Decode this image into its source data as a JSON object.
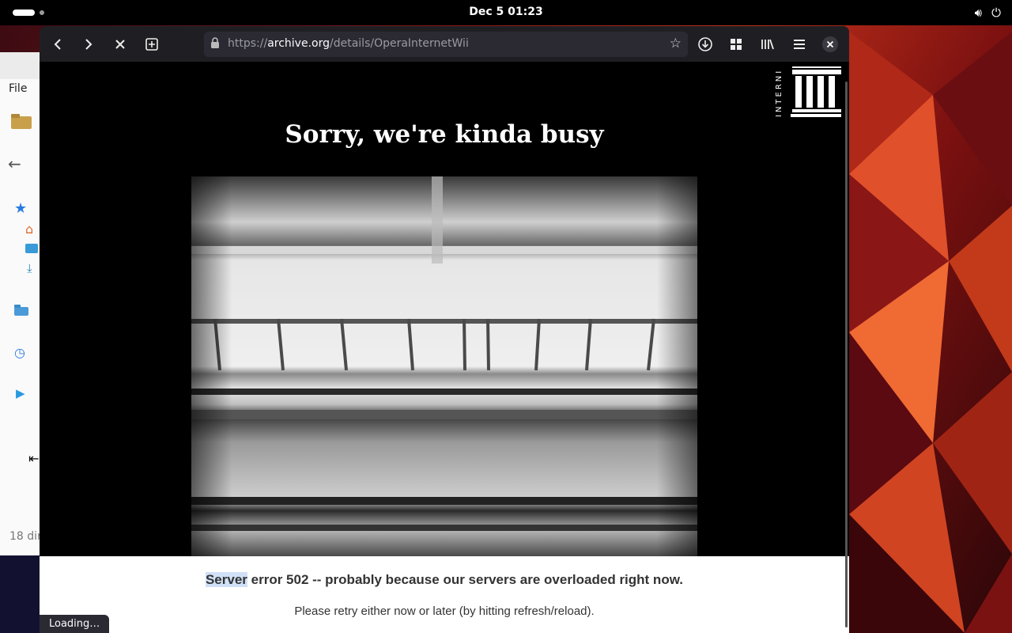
{
  "topbar": {
    "clock": "Dec 5  01:23",
    "volume_icon": "volume-icon",
    "power_icon": "power-icon"
  },
  "file_manager": {
    "menu_file": "File",
    "footer": "18 dir"
  },
  "browser": {
    "url_scheme": "https://",
    "url_host": "archive.org",
    "url_path": "/details/OperaInternetWii",
    "status": "Loading…",
    "accent": "#1f1f23"
  },
  "page": {
    "logo_text": "INTERNI",
    "headline": "Sorry, we're kinda busy",
    "error_selected": "Server",
    "error_rest": " error 502 -- probably because our servers are overloaded right now.",
    "retry": "Please retry either now or later (by hitting refresh/reload)."
  }
}
